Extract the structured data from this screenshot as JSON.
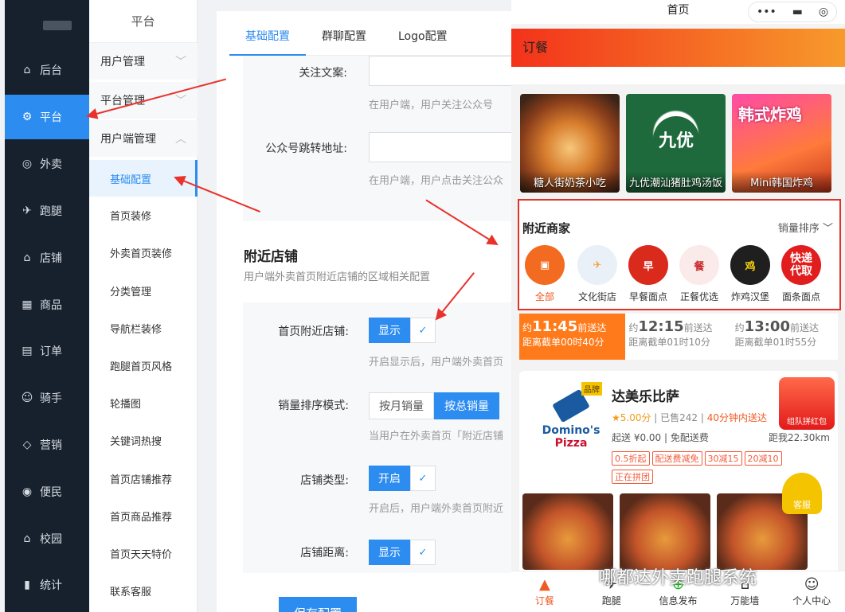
{
  "sidebar": {
    "items": [
      {
        "label": "后台",
        "icon": "home-icon"
      },
      {
        "label": "平台",
        "icon": "gear-icon"
      },
      {
        "label": "外卖",
        "icon": "takeout-icon"
      },
      {
        "label": "跑腿",
        "icon": "runner-icon"
      },
      {
        "label": "店铺",
        "icon": "store-icon"
      },
      {
        "label": "商品",
        "icon": "grid-icon"
      },
      {
        "label": "订单",
        "icon": "order-icon"
      },
      {
        "label": "骑手",
        "icon": "rider-icon"
      },
      {
        "label": "营销",
        "icon": "diamond-icon"
      },
      {
        "label": "便民",
        "icon": "service-icon"
      },
      {
        "label": "校园",
        "icon": "campus-icon"
      },
      {
        "label": "统计",
        "icon": "chart-icon"
      }
    ]
  },
  "submenu": {
    "title": "平台",
    "groups": [
      "用户管理",
      "平台管理",
      "用户端管理"
    ],
    "items": [
      "基础配置",
      "首页装修",
      "外卖首页装修",
      "分类管理",
      "导航栏装修",
      "跑腿首页风格",
      "轮播图",
      "关键词热搜",
      "首页店铺推荐",
      "首页商品推荐",
      "首页天天特价",
      "联系客服"
    ]
  },
  "tabs": [
    "基础配置",
    "群聊配置",
    "Logo配置"
  ],
  "form": {
    "follow_label": "关注文案:",
    "follow_hint": "在用户端，用户关注公众号",
    "jump_label": "公众号跳转地址:",
    "jump_hint": "在用户端，用户点击关注公众",
    "section_title": "附近店铺",
    "section_sub": "用户端外卖首页附近店铺的区域相关配置",
    "nearby_label": "首页附近店铺:",
    "show": "显示",
    "nearby_hint": "开启显示后，用户端外卖首页",
    "sort_label": "销量排序模式:",
    "sort_opt1": "按月销量",
    "sort_opt2": "按总销量",
    "sort_hint": "当用户在外卖首页「附近店铺",
    "type_label": "店铺类型:",
    "open": "开启",
    "type_hint": "开启后，用户端外卖首页附近",
    "dist_label": "店铺距离:",
    "save": "保存配置"
  },
  "phone": {
    "title": "首页",
    "header": "订餐",
    "banners": [
      "糖人街奶茶小吃",
      "九优潮汕猪肚鸡汤饭",
      "Mini韩国炸鸡"
    ],
    "nearby_title": "附近商家",
    "sort": "销量排序",
    "cats": [
      "全部",
      "文化街店",
      "早餐面点",
      "正餐优选",
      "炸鸡汉堡",
      "面条面点"
    ],
    "slots": [
      {
        "pre": "约",
        "time": "11:45",
        "post": "前送达",
        "sub": "距离截单00时40分"
      },
      {
        "pre": "约",
        "time": "12:15",
        "post": "前送达",
        "sub": "距离截单01时10分"
      },
      {
        "pre": "约",
        "time": "13:00",
        "post": "前送达",
        "sub": "距离截单01时55分"
      }
    ],
    "shop": {
      "badge": "品牌",
      "name": "达美乐比萨",
      "rating": "★5.00分",
      "sold": "已售242",
      "time": "40分钟内送达",
      "min": "起送 ¥0.00",
      "fee": "免配送费",
      "dist": "距我22.30km",
      "tags": [
        "0.5折起",
        "配送费减免",
        "30减15",
        "20减10"
      ],
      "group": "正在拼团",
      "logo1": "Domino's",
      "logo2": "Pizza"
    },
    "service": "客服",
    "redpack": "组队拼红包",
    "nav": [
      "订餐",
      "跑腿",
      "信息发布",
      "万能墙",
      "个人中心"
    ]
  },
  "watermark": "哪都达外卖跑腿系统"
}
